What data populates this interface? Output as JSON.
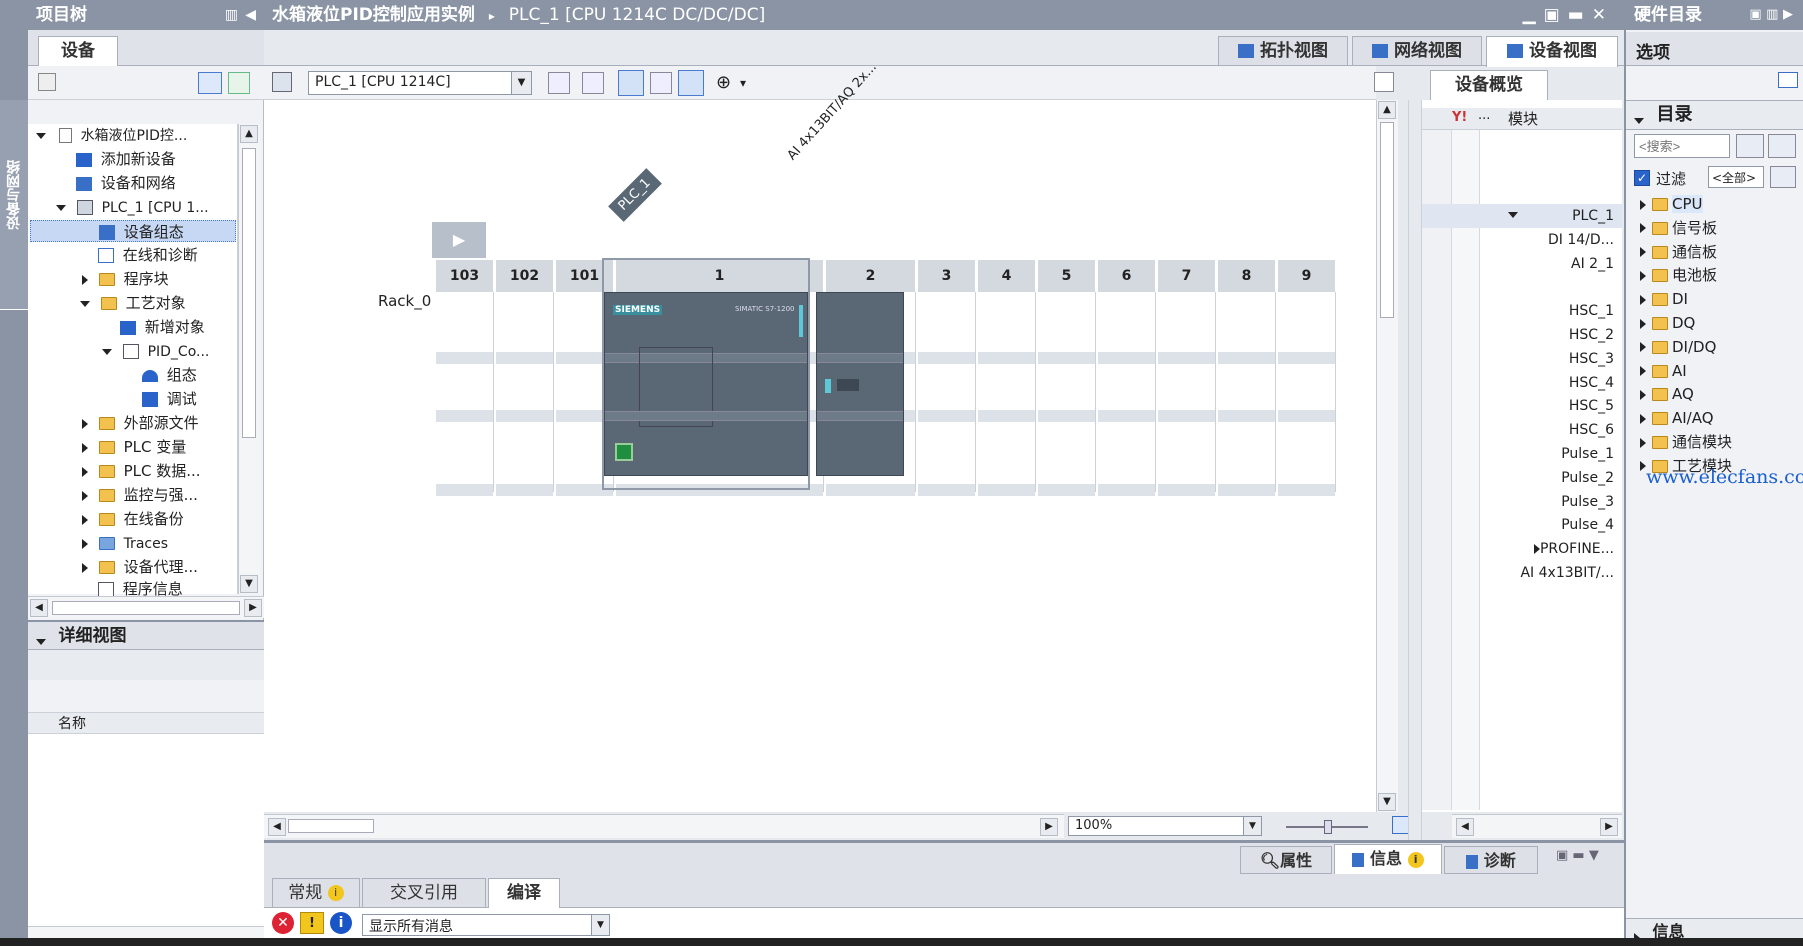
{
  "left_strip": {
    "label": "设备与网络"
  },
  "project_tree": {
    "title": "项目树",
    "tab": "设备",
    "items": [
      {
        "label": "水箱液位PID控..."
      },
      {
        "label": "添加新设备"
      },
      {
        "label": "设备和网络"
      },
      {
        "label": "PLC_1 [CPU 1..."
      },
      {
        "label": "设备组态"
      },
      {
        "label": "在线和诊断"
      },
      {
        "label": "程序块"
      },
      {
        "label": "工艺对象"
      },
      {
        "label": "新增对象"
      },
      {
        "label": "PID_Co..."
      },
      {
        "label": "组态"
      },
      {
        "label": "调试"
      },
      {
        "label": "外部源文件"
      },
      {
        "label": "PLC 变量"
      },
      {
        "label": "PLC 数据..."
      },
      {
        "label": "监控与强..."
      },
      {
        "label": "在线备份"
      },
      {
        "label": "Traces"
      },
      {
        "label": "设备代理..."
      },
      {
        "label": "程序信息"
      }
    ]
  },
  "detail_view": {
    "title": "详细视图",
    "col_name": "名称"
  },
  "breadcrumb": {
    "project": "水箱液位PID控制应用实例",
    "sep": "▸",
    "device": "PLC_1 [CPU 1214C DC/DC/DC]"
  },
  "view_tabs": {
    "topology": "拓扑视图",
    "network": "网络视图",
    "device": "设备视图"
  },
  "toolbar": {
    "device_select": "PLC_1 [CPU 1214C]"
  },
  "canvas": {
    "plc_tag": "PLC_1",
    "module_tag": "AI 4x13BIT/AQ 2x...",
    "rack_label": "Rack_0",
    "slots": [
      "103",
      "102",
      "101",
      "1",
      "2",
      "3",
      "4",
      "5",
      "6",
      "7",
      "8",
      "9"
    ],
    "cpu_brand": "SIEMENS",
    "cpu_model": "SIMATIC S7-1200",
    "zoom": "100%"
  },
  "overview": {
    "tab": "设备概览",
    "col_module": "模块",
    "col_dots": "...",
    "rows": [
      "PLC_1",
      "DI 14/D...",
      "AI 2_1",
      "",
      "HSC_1",
      "HSC_2",
      "HSC_3",
      "HSC_4",
      "HSC_5",
      "HSC_6",
      "Pulse_1",
      "Pulse_2",
      "Pulse_3",
      "Pulse_4",
      "PROFINE...",
      "AI 4x13BIT/..."
    ]
  },
  "catalog": {
    "title": "硬件目录",
    "options": "选项",
    "section": "目录",
    "search_placeholder": "<搜索>",
    "filter_label": "过滤",
    "filter_value": "<全部>",
    "items": [
      "CPU",
      "信号板",
      "通信板",
      "电池板",
      "DI",
      "DQ",
      "DI/DQ",
      "AI",
      "AQ",
      "AI/AQ",
      "通信模块",
      "工艺模块"
    ],
    "bottom": "信息",
    "watermark": "www.elecfans.com"
  },
  "inspector": {
    "tabs": {
      "properties": "属性",
      "info": "信息",
      "diag": "诊断"
    },
    "subtabs": [
      "常规",
      "交叉引用",
      "编译"
    ],
    "filter": "显示所有消息"
  },
  "colors": {
    "title_bar": "#8a94a4",
    "accent": "#2a63c9",
    "cpu_body": "#5a6876"
  }
}
